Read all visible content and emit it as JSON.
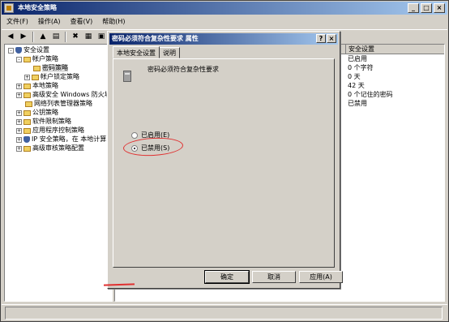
{
  "window": {
    "title": "本地安全策略",
    "controls": [
      "_",
      "□",
      "×"
    ]
  },
  "menubar": {
    "items": [
      "文件(F)",
      "操作(A)",
      "查看(V)",
      "帮助(H)"
    ]
  },
  "toolbar": {
    "buttons": [
      "back-icon",
      "forward-icon",
      "up-folder-icon",
      "tree-view-icon",
      "delete-icon",
      "properties-icon",
      "export-icon"
    ]
  },
  "tree": {
    "items": [
      {
        "label": "安全设置",
        "indent": 0,
        "expander": "-",
        "icon": "shield"
      },
      {
        "label": "帐户策略",
        "indent": 1,
        "expander": "-",
        "icon": "folder"
      },
      {
        "label": "密码策略",
        "indent": 2,
        "expander": "",
        "icon": "folder",
        "selected": true
      },
      {
        "label": "帐户锁定策略",
        "indent": 2,
        "expander": "+",
        "icon": "folder"
      },
      {
        "label": "本地策略",
        "indent": 1,
        "expander": "+",
        "icon": "folder"
      },
      {
        "label": "高级安全 Windows 防火墙",
        "indent": 1,
        "expander": "+",
        "icon": "folder"
      },
      {
        "label": "网络列表管理器策略",
        "indent": 1,
        "expander": "",
        "icon": "folder"
      },
      {
        "label": "公钥策略",
        "indent": 1,
        "expander": "+",
        "icon": "folder"
      },
      {
        "label": "软件限制策略",
        "indent": 1,
        "expander": "+",
        "icon": "folder"
      },
      {
        "label": "应用程序控制策略",
        "indent": 1,
        "expander": "+",
        "icon": "folder"
      },
      {
        "label": "IP 安全策略，在 本地计算",
        "indent": 1,
        "expander": "+",
        "icon": "shield"
      },
      {
        "label": "高级审核策略配置",
        "indent": 1,
        "expander": "+",
        "icon": "folder"
      }
    ]
  },
  "list": {
    "header": "安全设置",
    "rows": [
      "已启用",
      "0 个字符",
      "0 天",
      "42 天",
      "0 个记住的密码",
      "已禁用"
    ]
  },
  "dialog": {
    "title": "密码必须符合复杂性要求 属性",
    "help_button": "?",
    "close_button": "×",
    "tabs": [
      "本地安全设置",
      "说明"
    ],
    "policy_name": "密码必须符合复杂性要求",
    "options": [
      {
        "label": "已启用(E)",
        "checked": false
      },
      {
        "label": "已禁用(S)",
        "checked": true
      }
    ],
    "buttons": {
      "ok": "确定",
      "cancel": "取消",
      "apply": "应用(A)"
    }
  },
  "colors": {
    "annotation": "#e03030",
    "titlebar_start": "#0a246a",
    "titlebar_end": "#a6caf0"
  }
}
